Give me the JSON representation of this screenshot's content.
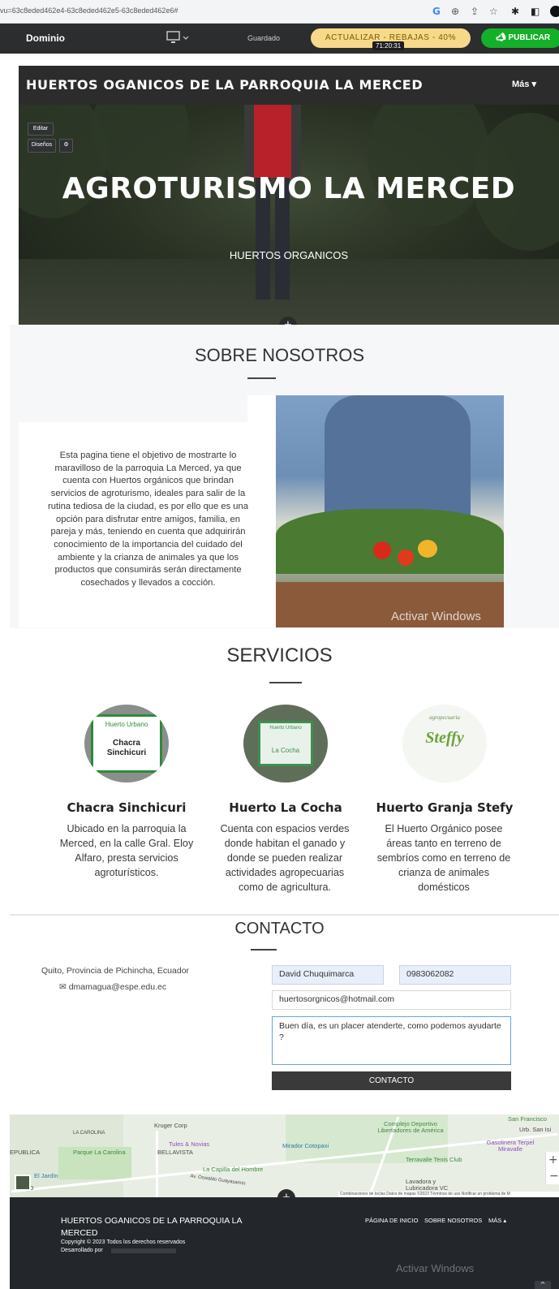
{
  "browser": {
    "url": "vu=63c8eded462e4-63c8eded462e5-63c8eded462e6#",
    "icons": [
      "google-icon",
      "zoom-icon",
      "share-icon",
      "star-icon",
      "extensions-icon",
      "sidebar-icon",
      "profile-icon"
    ]
  },
  "editor": {
    "site_name": "Dominio",
    "saved": "Guardado",
    "upgrade": "ACTUALIZAR - REBAJAS - 40%",
    "timer": "71:20:31",
    "publish": "PUBLICAR"
  },
  "header": {
    "title": "HUERTOS OGANICOS DE LA PARROQUIA LA MERCED",
    "more": "Más ▾"
  },
  "hero": {
    "edit_label": "Editar",
    "designs_label": "Diseños",
    "title": "AGROTURISMO LA MERCED",
    "subtitle": "HUERTOS ORGANICOS"
  },
  "about": {
    "heading": "SOBRE NOSOTROS",
    "text": "Esta pagina tiene el objetivo de mostrarte lo maravilloso de la parroquia La Merced, ya que cuenta con Huertos orgánicos que brindan servicios de agroturismo, ideales para salir de la rutina tediosa de la ciudad, es por ello que es una opción para disfrutar entre amigos, familia, en pareja y más, teniendo  en cuenta que adquirirán conocimiento de la importancia del cuidado del ambiente y la crianza de animales ya que los  productos que consumirás serán directamente cosechados y llevados a cocción.",
    "watermark": "Activar Windows"
  },
  "services": {
    "heading": "SERVICIOS",
    "items": [
      {
        "name": "Chacra Sinchicuri",
        "sign_top": "Huerto Urbano",
        "sign_text": "Chacra Sinchicuri",
        "description": "Ubicado en la parroquia la Merced, en la calle Gral. Eloy Alfaro, presta servicios agroturísticos."
      },
      {
        "name": "Huerto La Cocha",
        "sign_top": "Huerto Urbano",
        "sign_text": "La Cocha",
        "description": "Cuenta con espacios verdes donde habitan el ganado y donde se pueden realizar actividades agropecuarias como de agricultura."
      },
      {
        "name": "Huerto Granja Stefy",
        "sign_top": "agropecuaria",
        "sign_text": "Steffy",
        "description": "El Huerto Orgánico posee áreas tanto en terreno de sembríos como en terreno de crianza de animales domésticos"
      }
    ]
  },
  "contact": {
    "heading": "CONTACTO",
    "address": "Quito, Provincia de Pichincha, Ecuador",
    "email": "dmamagua@espe.edu.ec",
    "name_value": "David Chuquimarca",
    "phone_value": "0983062082",
    "email_value": "huertosorgnicos@hotmail.com",
    "message_value": "Buen día, es un placer atenderte, como podemos ayudarte ?",
    "submit": "CONTACTO"
  },
  "map": {
    "labels": [
      "Kruger Corp",
      "LA CAROLINA",
      "Parque La Carolina",
      "EPUBLICA",
      "Tules & Novias",
      "BELLAVISTA",
      "Mirador Cotopaxi",
      "Complejo Deportivo Libertadores de América",
      "San Francisco",
      "Urb. San Isi",
      "Gasolinera Terpel Miravalle",
      "Terravalle Tenis Club",
      "La Capilla del Hombre",
      "El Jardín",
      "ALVO",
      "Av. Oswaldo Guayasamín",
      "Lavadora y Lubricadora VC",
      "Combinaciones de teclas   Datos de mapas ©2023   Términos de uso   Notificar un problema de M"
    ]
  },
  "footer": {
    "title": "HUERTOS OGANICOS DE LA PARROQUIA LA MERCED",
    "copyright": "Copyright © 2023 Todos los derechos reservados",
    "developer_label": "Desarrollado por",
    "links": [
      "PÁGINA DE INICIO",
      "SOBRE NOSOTROS",
      "MÁS ▴"
    ],
    "watermark": "Activar Windows"
  }
}
